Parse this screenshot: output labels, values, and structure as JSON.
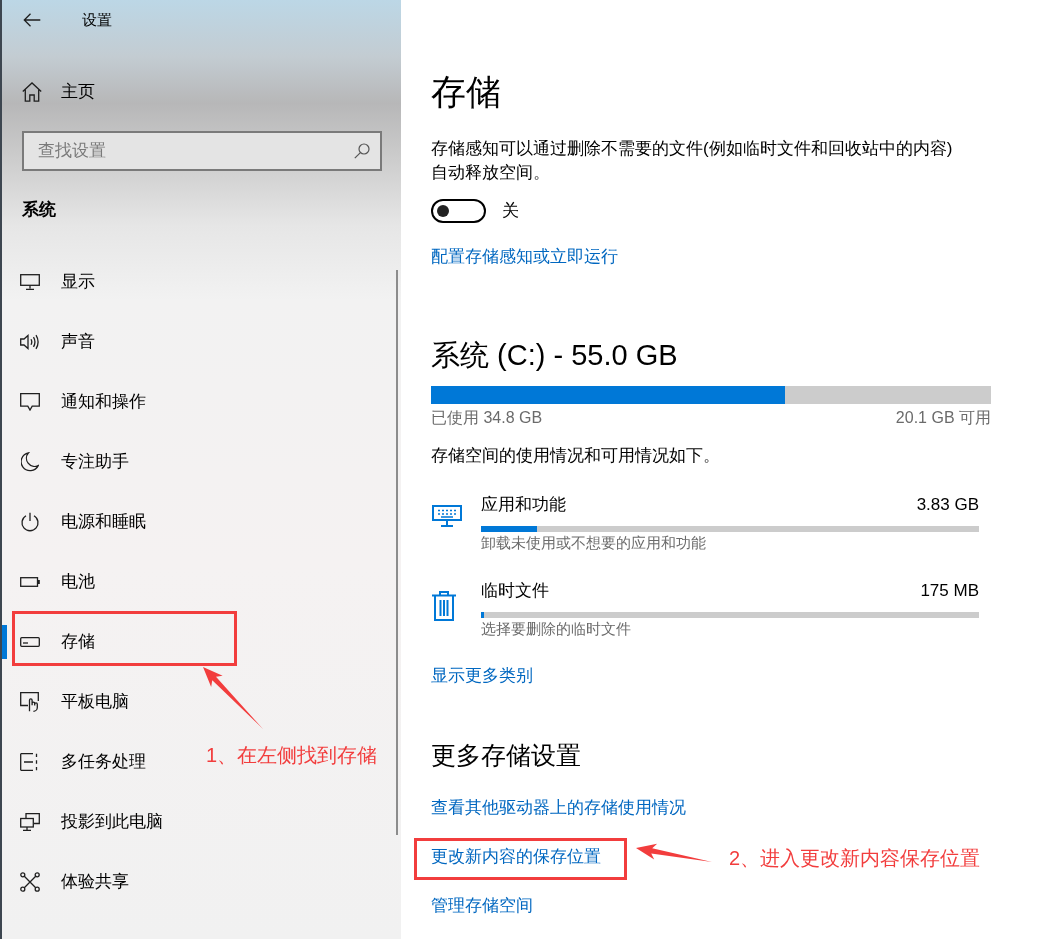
{
  "window": {
    "title": "设置"
  },
  "sidebar": {
    "home": "主页",
    "search": {
      "placeholder": "查找设置"
    },
    "section": "系统",
    "items": [
      {
        "label": "显示",
        "selected": false
      },
      {
        "label": "声音",
        "selected": false
      },
      {
        "label": "通知和操作",
        "selected": false
      },
      {
        "label": "专注助手",
        "selected": false
      },
      {
        "label": "电源和睡眠",
        "selected": false
      },
      {
        "label": "电池",
        "selected": false
      },
      {
        "label": "存储",
        "selected": true
      },
      {
        "label": "平板电脑",
        "selected": false
      },
      {
        "label": "多任务处理",
        "selected": false
      },
      {
        "label": "投影到此电脑",
        "selected": false
      },
      {
        "label": "体验共享",
        "selected": false
      }
    ]
  },
  "page": {
    "title": "存储",
    "storage_sense": {
      "description": "存储感知可以通过删除不需要的文件(例如临时文件和回收站中的内容)自动释放空间。",
      "on": false,
      "state_label": "关",
      "link": "配置存储感知或立即运行"
    },
    "drive": {
      "title": "系统 (C:) - 55.0 GB",
      "level": 0.633,
      "used": "已使用 34.8 GB",
      "free": "20.1 GB 可用",
      "summary": "存储空间的使用情况和可用情况如下。"
    },
    "categories": [
      {
        "name": "应用和功能",
        "size": "3.83 GB",
        "level": 0.112,
        "description": "卸载未使用或不想要的应用和功能"
      },
      {
        "name": "临时文件",
        "size": "175 MB",
        "level": 0.006,
        "description": "选择要删除的临时文件"
      }
    ],
    "more_link": "显示更多类别",
    "more_settings": {
      "title": "更多存储设置",
      "links": [
        "查看其他驱动器上的存储使用情况",
        "更改新内容的保存位置",
        "管理存储空间"
      ]
    }
  },
  "annotations": [
    {
      "text": "1、在左侧找到存储"
    },
    {
      "text": "2、进入更改新内容保存位置"
    }
  ]
}
